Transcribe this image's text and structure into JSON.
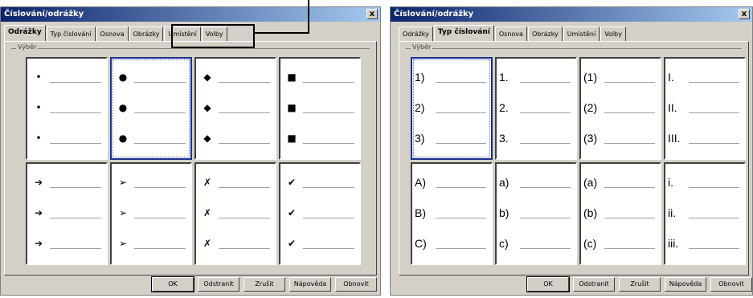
{
  "dialogs": [
    {
      "title": "Číslování/odrážky",
      "close": "x",
      "tabs": [
        "Odrážky",
        "Typ číslování",
        "Osnova",
        "Obrázky",
        "Umístění",
        "Volby"
      ],
      "active_tab": 0,
      "group_label": "Výběr",
      "cells": [
        [
          "•",
          "•",
          "•"
        ],
        [
          "●",
          "●",
          "●"
        ],
        [
          "◆",
          "◆",
          "◆"
        ],
        [
          "■",
          "■",
          "■"
        ],
        [
          "➔",
          "➔",
          "➔"
        ],
        [
          "➢",
          "➢",
          "➢"
        ],
        [
          "✗",
          "✗",
          "✗"
        ],
        [
          "✔",
          "✔",
          "✔"
        ]
      ],
      "selected_cell": 1,
      "buttons": [
        "OK",
        "Odstranit",
        "Zrušit",
        "Nápověda",
        "Obnovit"
      ]
    },
    {
      "title": "Číslování/odrážky",
      "close": "x",
      "tabs": [
        "Odrážky",
        "Typ číslování",
        "Osnova",
        "Obrázky",
        "Umístění",
        "Volby"
      ],
      "active_tab": 1,
      "group_label": "Výběr",
      "cells": [
        [
          "1)",
          "2)",
          "3)"
        ],
        [
          "1.",
          "2.",
          "3."
        ],
        [
          "(1)",
          "(2)",
          "(3)"
        ],
        [
          "I.",
          "II.",
          "III."
        ],
        [
          "A)",
          "B)",
          "C)"
        ],
        [
          "a)",
          "b)",
          "c)"
        ],
        [
          "(a)",
          "(b)",
          "(c)"
        ],
        [
          "i.",
          "ii.",
          "iii."
        ]
      ],
      "selected_cell": 0,
      "buttons": [
        "OK",
        "Odstranit",
        "Zrušit",
        "Nápověda",
        "Obnovit"
      ]
    }
  ]
}
